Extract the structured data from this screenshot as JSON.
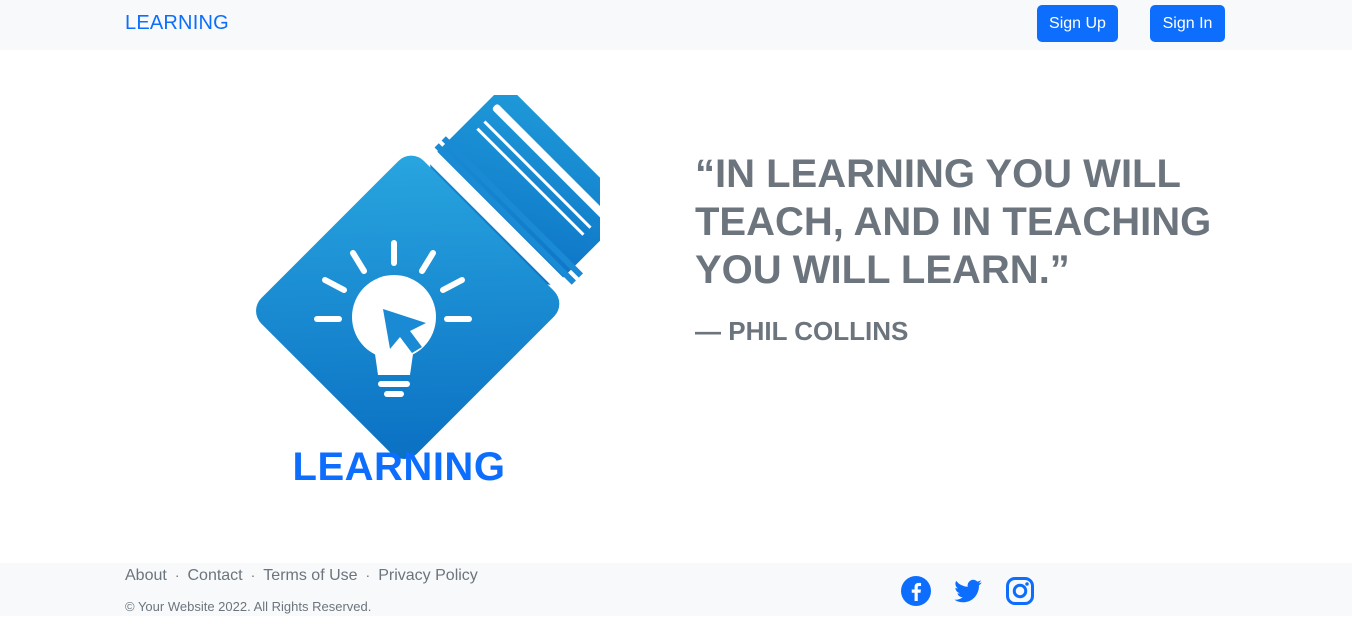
{
  "navbar": {
    "brand": "LEARNING",
    "signup_label": "Sign Up",
    "signin_label": "Sign In"
  },
  "hero": {
    "logo_text": "LEARNING",
    "quote": "“In learning you will teach, and in teaching you will learn.”",
    "author": "— Phil Collins"
  },
  "footer": {
    "links": [
      "About",
      "Contact",
      "Terms of Use",
      "Privacy Policy"
    ],
    "separator": "·",
    "copyright": "© Your Website 2022. All Rights Reserved.",
    "social": [
      "facebook-icon",
      "twitter-icon",
      "instagram-icon"
    ]
  },
  "colors": {
    "accent": "#0d6efd",
    "text_muted": "#6c757d",
    "bar_background": "#f8f9fa",
    "logo_blue": "#1a8ad4"
  }
}
